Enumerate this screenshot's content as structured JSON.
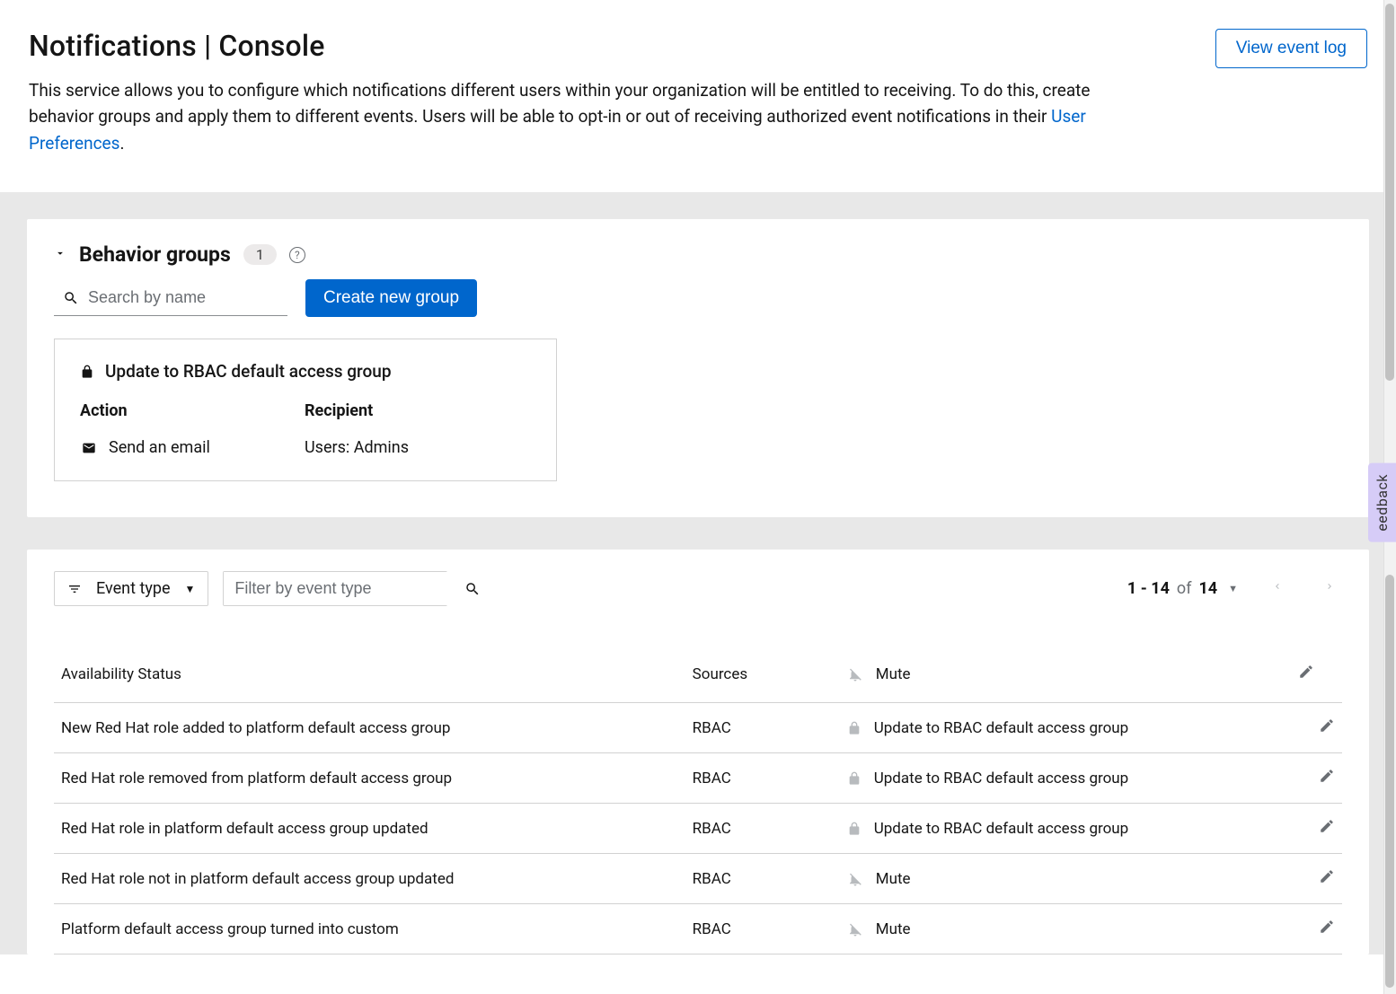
{
  "header": {
    "title": "Notifications | Console",
    "description_before": "This service allows you to configure which notifications different users within your organization will be entitled to receiving. To do this, create behavior groups and apply them to different events. Users will be able to opt-in or out of receiving authorized event notifications in their ",
    "user_prefs_link": "User Preferences",
    "description_after": ".",
    "view_event_log": "View event log"
  },
  "behavior": {
    "section_title": "Behavior groups",
    "count": "1",
    "search_placeholder": "Search by name",
    "create_button": "Create new group",
    "group": {
      "title": "Update to RBAC default access group",
      "col_action": "Action",
      "col_recipient": "Recipient",
      "action_value": "Send an email",
      "recipient_value": "Users: Admins"
    }
  },
  "events": {
    "dropdown_label": "Event type",
    "filter_placeholder": "Filter by event type",
    "pagination": {
      "range": "1 - 14",
      "of": "of",
      "total": "14"
    },
    "columns": {
      "availability": "Availability Status",
      "sources": "Sources",
      "action": "Mute"
    },
    "rows": [
      {
        "event": "New Red Hat role added to platform default access group",
        "source": "RBAC",
        "locked": true,
        "action": "Update to RBAC default access group"
      },
      {
        "event": "Red Hat role removed from platform default access group",
        "source": "RBAC",
        "locked": true,
        "action": "Update to RBAC default access group"
      },
      {
        "event": "Red Hat role in platform default access group updated",
        "source": "RBAC",
        "locked": true,
        "action": "Update to RBAC default access group"
      },
      {
        "event": "Red Hat role not in platform default access group updated",
        "source": "RBAC",
        "locked": false,
        "action": "Mute"
      },
      {
        "event": "Platform default access group turned into custom",
        "source": "RBAC",
        "locked": false,
        "action": "Mute"
      }
    ]
  },
  "feedback_label": "eedback"
}
